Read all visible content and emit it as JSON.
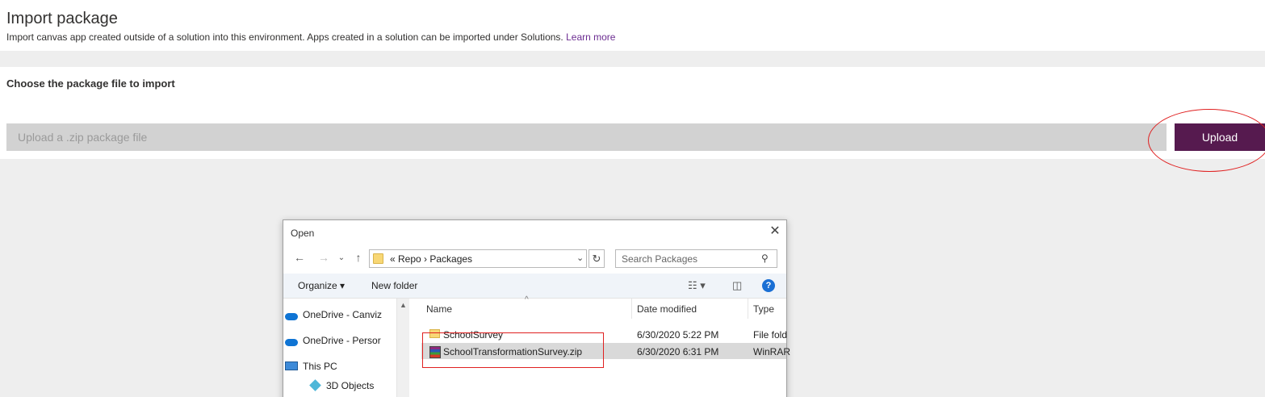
{
  "header": {
    "title": "Import package",
    "subtitle": "Import canvas app created outside of a solution into this environment. Apps created in a solution can be imported under Solutions.",
    "learn_more": "Learn more"
  },
  "import_card": {
    "heading": "Choose the package file to import",
    "file_placeholder": "Upload a .zip package file",
    "upload_label": "Upload"
  },
  "dialog": {
    "title": "Open",
    "address": "«  Repo  ›  Packages",
    "search_placeholder": "Search Packages",
    "toolbar": {
      "organize": "Organize ▾",
      "new_folder": "New folder"
    },
    "nav_items": [
      {
        "label": "OneDrive - Canviz",
        "icon": "onedrive-icon"
      },
      {
        "label": "OneDrive - Persor",
        "icon": "onedrive-icon"
      },
      {
        "label": "This PC",
        "icon": "this-pc-icon"
      },
      {
        "label": "3D Objects",
        "icon": "3d-objects-icon"
      }
    ],
    "columns": {
      "name": "Name",
      "date": "Date modified",
      "type": "Type"
    },
    "files": [
      {
        "name": "SchoolSurvey",
        "date": "6/30/2020 5:22 PM",
        "type": "File fold",
        "icon": "folder-icon"
      },
      {
        "name": "SchoolTransformationSurvey.zip",
        "date": "6/30/2020 6:31 PM",
        "type": "WinRAR",
        "icon": "winrar-zip-icon"
      }
    ]
  },
  "colors": {
    "upload_button": "#561a4f",
    "link": "#6b2c91",
    "annotation": "#e02020",
    "input_bg": "#d2d2d2"
  }
}
